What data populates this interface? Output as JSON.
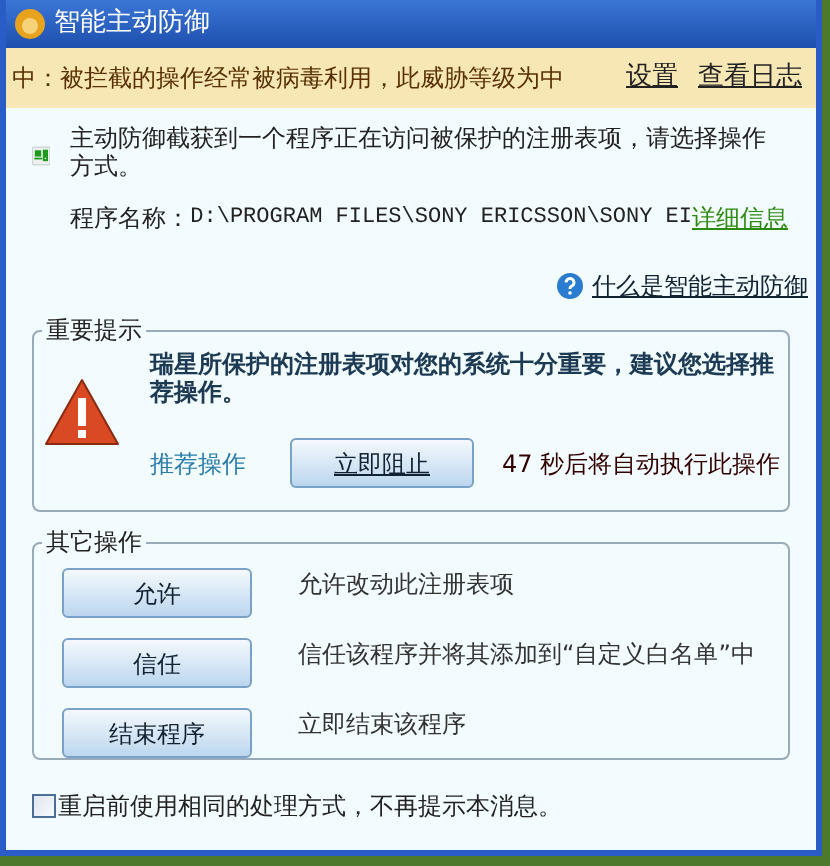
{
  "window": {
    "title": "智能主动防御"
  },
  "threat_bar": {
    "message": "中：被拦截的操作经常被病毒利用，此威胁等级为中",
    "links": [
      "设置",
      "查看日志"
    ]
  },
  "info": {
    "message": "主动防御截获到一个程序正在访问被保护的注册表项，请选择操作方式。",
    "program_label": "程序名称：",
    "program_path": "D:\\PROGRAM FILES\\SONY ERICSSON\\SONY EI",
    "details_link": "详细信息",
    "help_link": "什么是智能主动防御"
  },
  "important": {
    "title": "重要提示",
    "message": "瑞星所保护的注册表项对您的系统十分重要，建议您选择推荐操作。",
    "recommend_label": "推荐操作",
    "recommend_button": "立即阻止",
    "countdown": "47 秒后将自动执行此操作"
  },
  "other": {
    "title": "其它操作",
    "actions": [
      {
        "button": "允许",
        "description": "允许改动此注册表项"
      },
      {
        "button": "信任",
        "description": "信任该程序并将其添加到“自定义白名单”中"
      },
      {
        "button": "结束程序",
        "description": "立即结束该程序"
      }
    ]
  },
  "remember": {
    "label": "重启前使用相同的处理方式，不再提示本消息。",
    "checked": false
  }
}
